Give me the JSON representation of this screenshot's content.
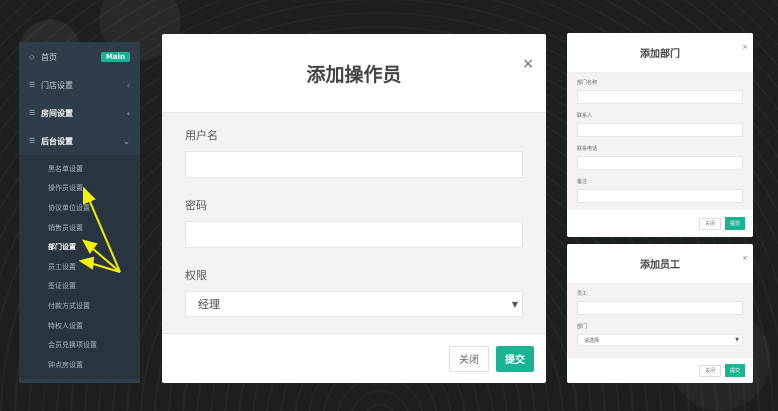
{
  "sidebar": {
    "top": [
      {
        "label": "首页",
        "badge": "Main",
        "icon": "diamond-icon"
      },
      {
        "label": "门店设置",
        "arrow": "‹"
      },
      {
        "label": "房间设置",
        "arrow": "‹"
      },
      {
        "label": "后台设置",
        "arrow": "⌄"
      }
    ],
    "sub": [
      "黑名单设置",
      "操作员设置",
      "协议单位设置",
      "销售员设置",
      "部门设置",
      "员工设置",
      "签证设置",
      "付款方式设置",
      "特权人设置",
      "会员兑换项设置",
      "钟点房设置"
    ]
  },
  "modal_operator": {
    "title": "添加操作员",
    "close": "×",
    "username_label": "用户名",
    "password_label": "密码",
    "permission_label": "权限",
    "permission_value": "经理",
    "close_button": "关闭",
    "submit_button": "提交"
  },
  "modal_department": {
    "title": "添加部门",
    "close": "×",
    "fields": [
      "部门名称",
      "联系人",
      "联系电话",
      "备注"
    ],
    "close_button": "关闭",
    "submit_button": "提交"
  },
  "modal_employee": {
    "title": "添加员工",
    "close": "×",
    "name_label": "员工",
    "dept_label": "部门",
    "dept_value": "请选择",
    "close_button": "关闭",
    "submit_button": "提交"
  },
  "colors": {
    "accent": "#1ab394",
    "sidebar": "#2f3d4a",
    "arrow": "#f2f200"
  }
}
